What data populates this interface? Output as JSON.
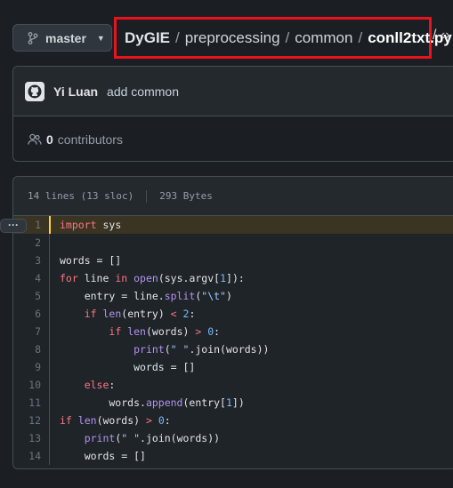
{
  "branch": {
    "name": "master"
  },
  "breadcrumb": {
    "repo": "DyGIE",
    "separator": "/",
    "dirs": [
      "preprocessing",
      "common"
    ],
    "file": "conll2txt.py",
    "tail": "/ ‹›"
  },
  "commit": {
    "author": "Yi Luan",
    "message": "add common"
  },
  "contributors": {
    "count": "0",
    "label": "contributors"
  },
  "file_info": {
    "lines": "14 lines (13 sloc)",
    "size": "293 Bytes"
  },
  "line_actions": {
    "label": "···"
  },
  "code": {
    "line_numbers": [
      "1",
      "2",
      "3",
      "4",
      "5",
      "6",
      "7",
      "8",
      "9",
      "10",
      "11",
      "12",
      "13",
      "14"
    ]
  },
  "colors": {
    "highlight_border": "#ffd33d",
    "breadcrumb_border": "#e8131d",
    "keyword": "#f97583",
    "function": "#b392f0",
    "string": "#9ecbff",
    "number": "#79b8ff"
  }
}
